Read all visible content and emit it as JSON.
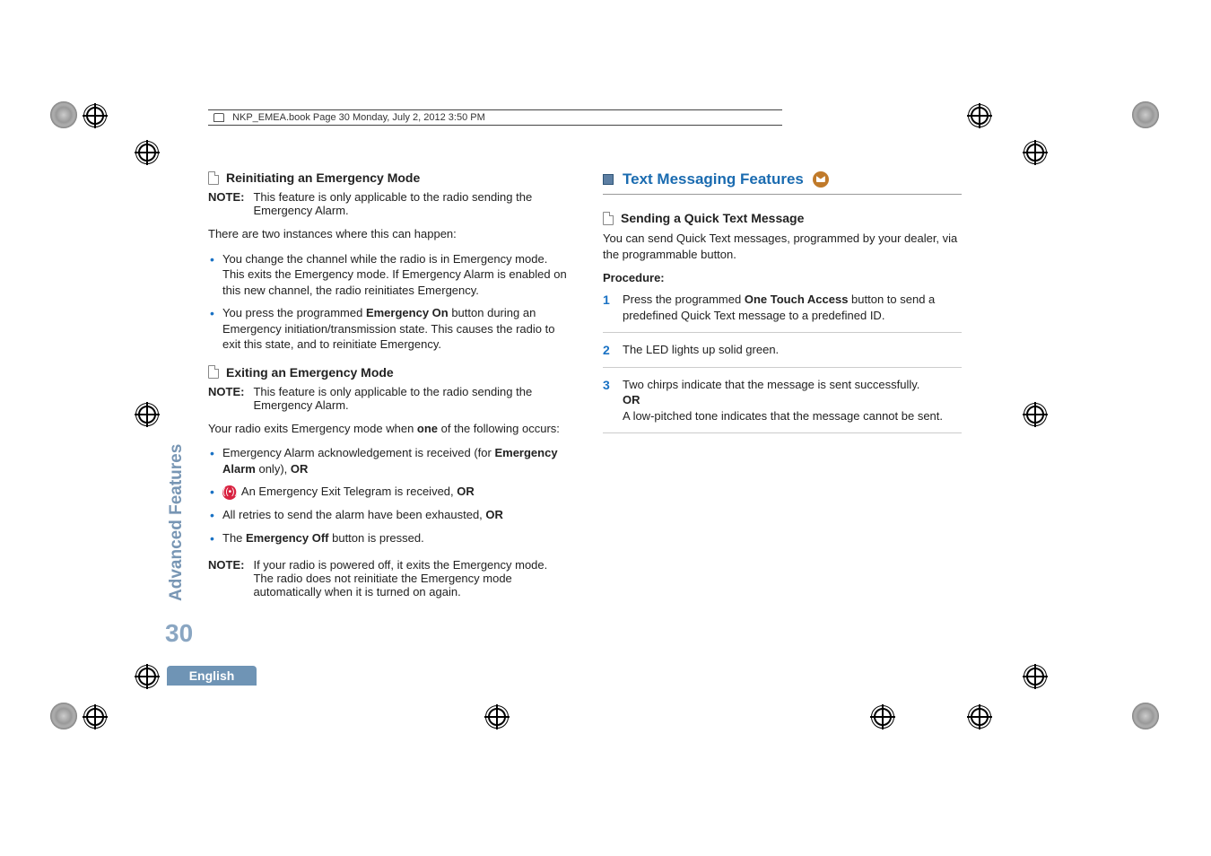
{
  "header": {
    "text": "NKP_EMEA.book  Page 30  Monday, July 2, 2012  3:50 PM"
  },
  "side": {
    "tab": "Advanced Features",
    "page_num": "30",
    "language": "English"
  },
  "left": {
    "h1": "Reinitiating an Emergency Mode",
    "note_label": "NOTE:",
    "note1": "This feature is only applicable to the radio sending the Emergency Alarm.",
    "p1": "There are two instances where this can happen:",
    "b1": "You change the channel while the radio is in Emergency mode. This exits the Emergency mode. If Emergency Alarm is enabled on this new channel, the radio reinitiates Emergency.",
    "b2a": "You press the programmed ",
    "b2b": "Emergency On",
    "b2c": " button during an Emergency initiation/transmission state. This causes the radio to exit this state, and to reinitiate Emergency.",
    "h2": "Exiting an Emergency Mode",
    "note2": "This feature is only applicable to the radio sending the Emergency Alarm.",
    "p2a": "Your radio exits Emergency mode when ",
    "p2b": "one",
    "p2c": " of the following occurs:",
    "c1a": "Emergency Alarm acknowledgement is received (for ",
    "c1b": "Emergency Alarm",
    "c1c": " only), ",
    "c1d": "OR",
    "c2a": " An Emergency Exit Telegram is received, ",
    "c2b": "OR",
    "c3a": "All retries to send the alarm have been exhausted, ",
    "c3b": "OR",
    "c4a": "The ",
    "c4b": "Emergency Off",
    "c4c": " button is pressed.",
    "note3": "If your radio is powered off, it exits the Emergency mode. The radio does not reinitiate the Emergency mode automatically when it is turned on again."
  },
  "right": {
    "section": "Text Messaging Features",
    "h1": "Sending a Quick Text Message",
    "p1": "You can send Quick Text messages, programmed by your dealer, via the programmable button.",
    "proc": "Procedure:",
    "s1a": "Press the programmed ",
    "s1b": "One Touch Access",
    "s1c": " button to send a predefined Quick Text message to a predefined ID.",
    "s2": "The LED lights up solid green.",
    "s3a": "Two chirps indicate that the message is sent successfully.",
    "s3b": "OR",
    "s3c": "A low-pitched tone indicates that the message cannot be sent."
  }
}
